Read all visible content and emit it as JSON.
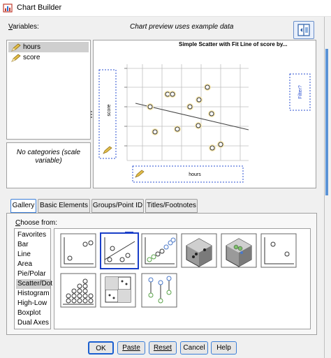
{
  "window": {
    "title": "Chart Builder"
  },
  "variables_label": "Variables:",
  "preview_caption": "Chart preview uses example data",
  "variables": [
    {
      "name": "hours",
      "selected": true
    },
    {
      "name": "score",
      "selected": false
    }
  ],
  "categories_text": "No categories (scale variable)",
  "preview": {
    "title": "Simple Scatter with Fit Line of score by...",
    "y_drop": "score",
    "x_drop": "hours",
    "filter_drop": "Filter?"
  },
  "tabs": [
    {
      "label": "Gallery",
      "active": true
    },
    {
      "label": "Basic Elements",
      "active": false
    },
    {
      "label": "Groups/Point ID",
      "active": false
    },
    {
      "label": "Titles/Footnotes",
      "active": false
    }
  ],
  "choose_from_label": "Choose from:",
  "chart_types": [
    {
      "label": "Favorites",
      "selected": false
    },
    {
      "label": "Bar",
      "selected": false
    },
    {
      "label": "Line",
      "selected": false
    },
    {
      "label": "Area",
      "selected": false
    },
    {
      "label": "Pie/Polar",
      "selected": false
    },
    {
      "label": "Scatter/Dot",
      "selected": true
    },
    {
      "label": "Histogram",
      "selected": false
    },
    {
      "label": "High-Low",
      "selected": false
    },
    {
      "label": "Boxplot",
      "selected": false
    },
    {
      "label": "Dual Axes",
      "selected": false
    }
  ],
  "gallery_icons": [
    "simple-scatter-icon",
    "scatter-fit-line-icon",
    "grouped-scatter-icon",
    "3d-scatter-icon",
    "grouped-3d-scatter-icon",
    "summary-point-icon",
    "dot-plot-icon",
    "scatter-matrix-icon",
    "drop-line-icon"
  ],
  "buttons": {
    "ok": "OK",
    "paste": "Paste",
    "reset": "Reset",
    "cancel": "Cancel",
    "help": "Help"
  },
  "colors": {
    "accent": "#3c7fd8",
    "point_fill": "#f6e7b0",
    "drop_zone_border": "#2a4fd0",
    "pencil": "#d8b040"
  }
}
